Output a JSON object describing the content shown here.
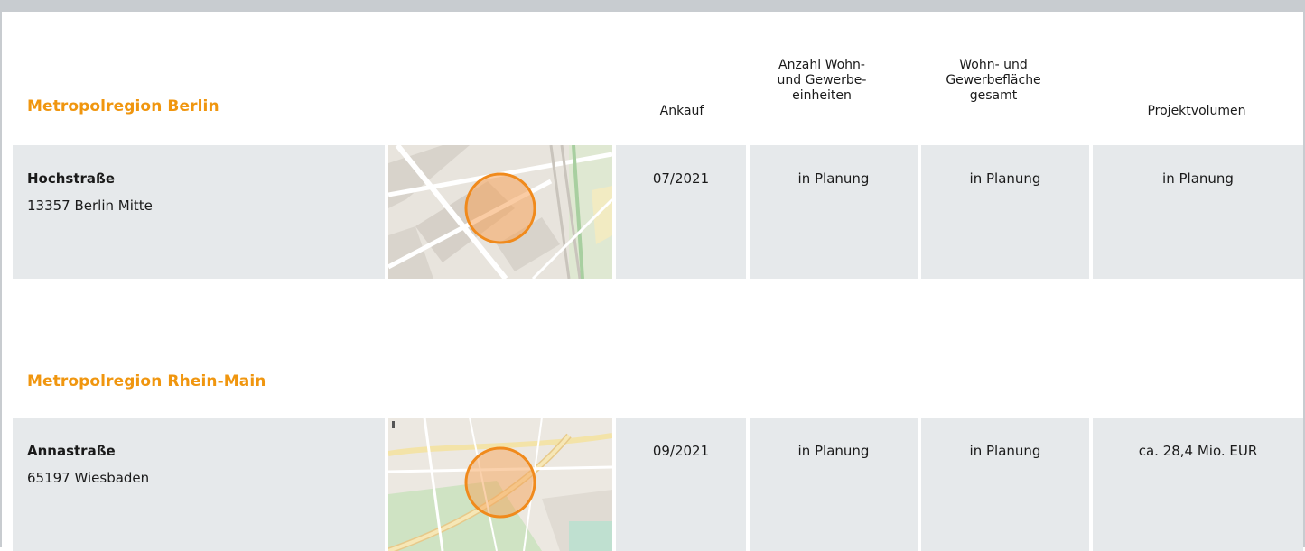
{
  "columns": {
    "ankauf": "Ankauf",
    "einheiten": "Anzahl Wohn-\nund Gewerbe-\neinheiten",
    "flaeche": "Wohn- und\nGewerbefläche\ngesamt",
    "volumen": "Projektvolumen"
  },
  "regions": [
    {
      "title": "Metropolregion Berlin",
      "project": {
        "street": "Hochstraße",
        "city": "13357 Berlin Mitte",
        "ankauf": "07/2021",
        "einheiten": "in Planung",
        "flaeche": "in Planung",
        "volumen": "in Planung",
        "map_icon": "location-map-thumbnail"
      }
    },
    {
      "title": "Metropolregion Rhein-Main",
      "project": {
        "street": "Annastraße",
        "city": "65197 Wiesbaden",
        "ankauf": "09/2021",
        "einheiten": "in Planung",
        "flaeche": "in Planung",
        "volumen": "ca. 28,4 Mio. EUR",
        "map_icon": "location-map-thumbnail"
      }
    }
  ],
  "colors": {
    "accent": "#f0960f",
    "cell_background": "#e6e9eb",
    "frame": "#c8ccd0",
    "marker": "#f08a1c"
  }
}
